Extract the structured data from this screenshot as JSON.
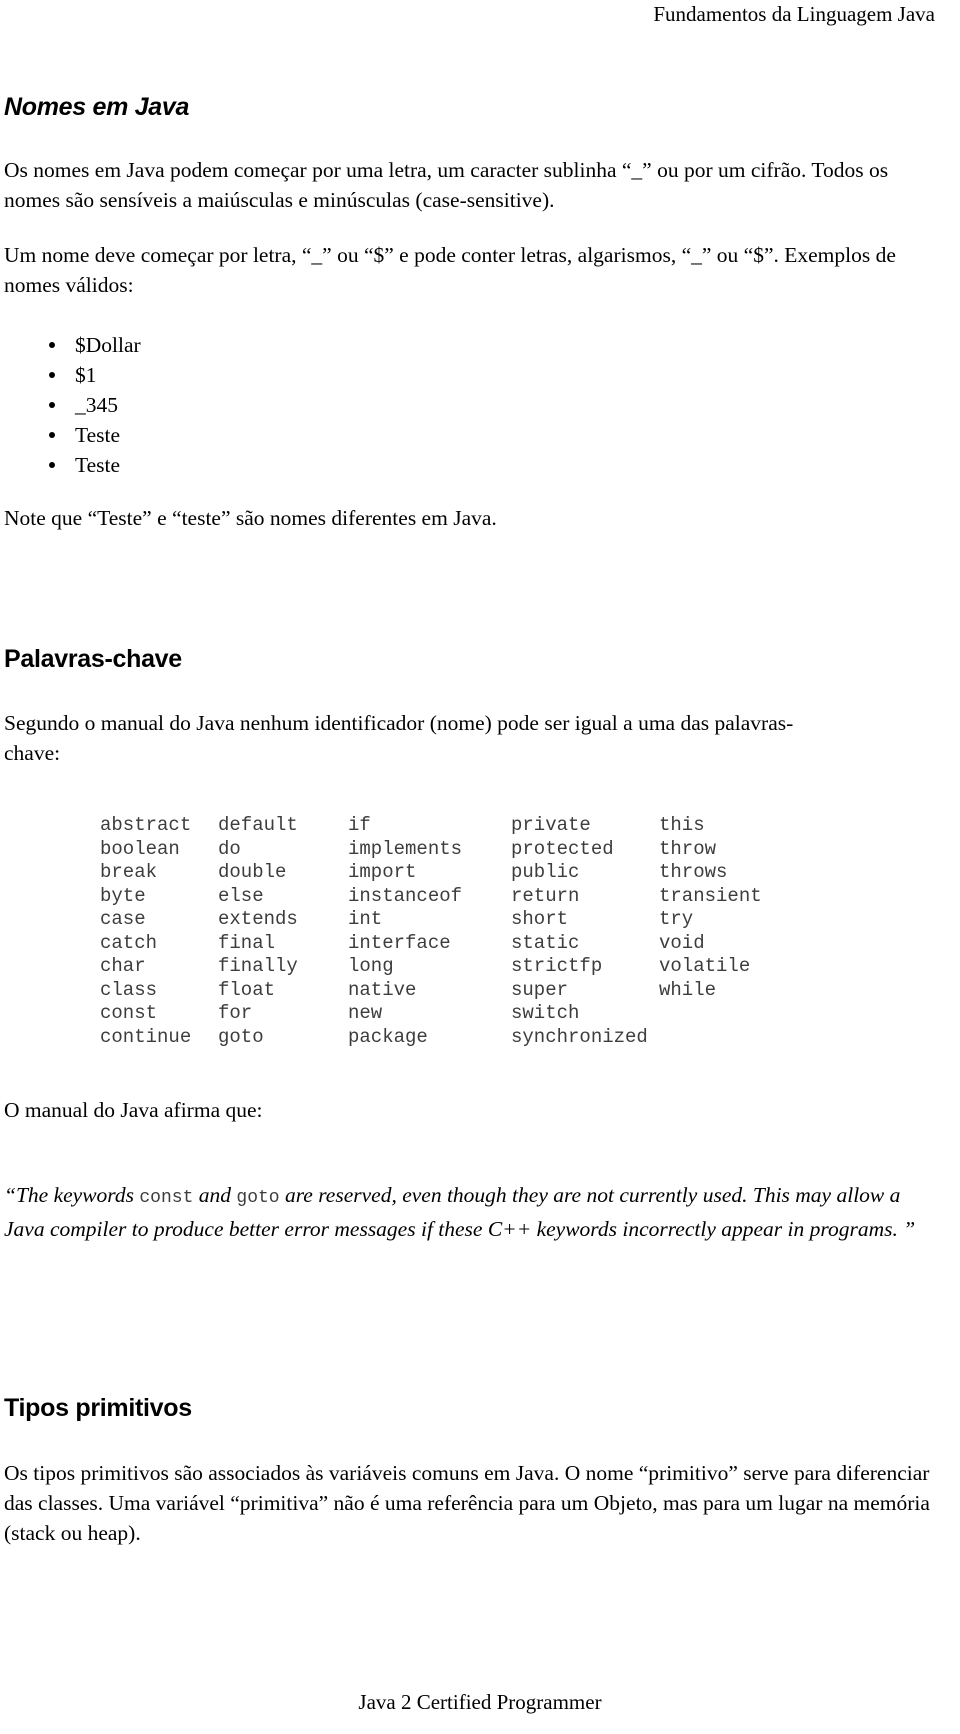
{
  "header": {
    "title": "Fundamentos da Linguagem Java"
  },
  "sections": {
    "nomes": {
      "heading": "Nomes em Java",
      "para1": "Os nomes em Java podem começar por uma letra, um caracter sublinha “_” ou por um cifrão. Todos os nomes são sensíveis a maiúsculas e minúsculas (case-sensitive).",
      "para2": "Um nome deve começar por letra, “_” ou “$” e pode conter letras, algarismos, “_” ou “$”. Exemplos de nomes válidos:",
      "examples": [
        "$Dollar",
        "$1",
        "_345",
        "Teste",
        "Teste"
      ],
      "note": "Note que “Teste” e “teste” são nomes diferentes em Java."
    },
    "palavras_chave": {
      "heading": "Palavras-chave",
      "intro": "Segundo o manual do Java nenhum identificador (nome) pode ser igual a uma das palavras-chave:",
      "after_table": "O manual do Java afirma que:",
      "quote_part1": "“The keywords ",
      "quote_mono1": "const",
      "quote_part2": " and ",
      "quote_mono2": "goto",
      "quote_part3": " are reserved, even though they are not currently used. This may allow a Java compiler to produce better error messages if these C++ keywords incorrectly appear in programs. ”"
    },
    "tipos_primitivos": {
      "heading": "Tipos primitivos",
      "para1": "Os tipos primitivos são associados às variáveis comuns em Java. O nome “primitivo” serve para diferenciar das classes. Uma variável “primitiva” não é uma referência para um Objeto, mas para um lugar na memória (stack ou heap)."
    }
  },
  "keyword_table": {
    "rows": [
      [
        "abstract",
        "default",
        "if",
        "private",
        "this"
      ],
      [
        "boolean",
        "do",
        "implements",
        "protected",
        "throw"
      ],
      [
        "break",
        "double",
        "import",
        "public",
        "throws"
      ],
      [
        "byte",
        "else",
        "instanceof",
        "return",
        "transient"
      ],
      [
        "case",
        "extends",
        "int",
        "short",
        "try"
      ],
      [
        "catch",
        "final",
        "interface",
        "static",
        "void"
      ],
      [
        "char",
        "finally",
        "long",
        "strictfp",
        "volatile"
      ],
      [
        "class",
        "float",
        "native",
        "super",
        "while"
      ],
      [
        "const",
        "for",
        "new",
        "switch",
        ""
      ],
      [
        "continue",
        "goto",
        "package",
        "synchronized",
        ""
      ]
    ]
  },
  "footer": {
    "text": "Java 2 Certified Programmer"
  }
}
